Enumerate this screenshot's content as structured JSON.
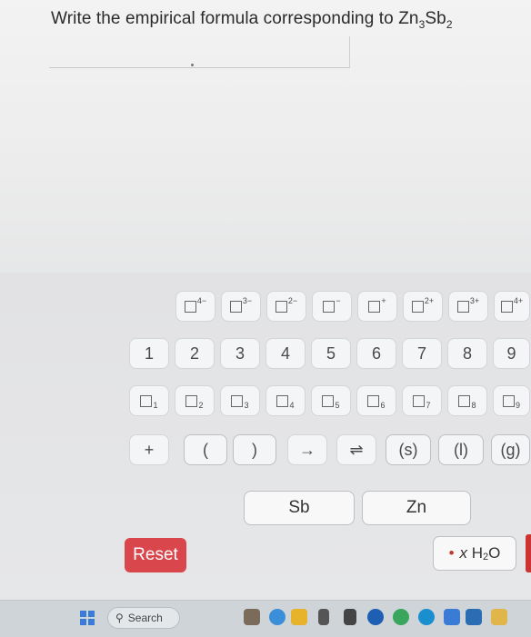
{
  "question": {
    "text": "Write the empirical formula corresponding to Zn",
    "sub1": "3",
    "mid": "Sb",
    "sub2": "2"
  },
  "charges": [
    "4−",
    "3−",
    "2−",
    "−",
    "+",
    "2+",
    "3+",
    "4+"
  ],
  "digits": [
    "1",
    "2",
    "3",
    "4",
    "5",
    "6",
    "7",
    "8",
    "9"
  ],
  "subscripts": [
    "1",
    "2",
    "3",
    "4",
    "5",
    "6",
    "7",
    "8",
    "9"
  ],
  "symbols": [
    "+",
    "(",
    ")",
    "→",
    "⇌",
    "(s)",
    "(l)",
    "(g)"
  ],
  "elements": [
    "Sb",
    "Zn"
  ],
  "reset_label": "Reset",
  "water": {
    "bullet": "•",
    "x": "x",
    "h": "H",
    "two": "2",
    "o": "O"
  },
  "taskbar": {
    "search_label": "Search"
  },
  "colors": {
    "reset": "#d9464c",
    "accent": "#3a7bd5"
  }
}
